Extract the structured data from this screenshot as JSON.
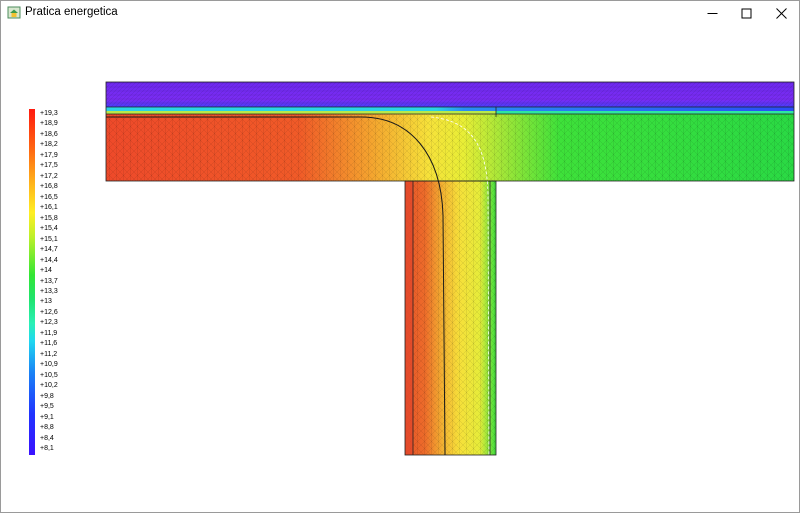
{
  "window": {
    "title": "Pratica energetica",
    "app_icon": "house-app-icon",
    "controls": [
      "minimize-icon",
      "maximize-icon",
      "close-icon"
    ]
  },
  "legend": {
    "labels": [
      "+19,3",
      "+18,9",
      "+18,6",
      "+18,2",
      "+17,9",
      "+17,5",
      "+17,2",
      "+16,8",
      "+16,5",
      "+16,1",
      "+15,8",
      "+15,4",
      "+15,1",
      "+14,7",
      "+14,4",
      "+14",
      "+13,7",
      "+13,3",
      "+13",
      "+12,6",
      "+12,3",
      "+11,9",
      "+11,6",
      "+11,2",
      "+10,9",
      "+10,5",
      "+10,2",
      "+9,8",
      "+9,5",
      "+9,1",
      "+8,8",
      "+8,4",
      "+8,1"
    ],
    "colors": {
      "max": "#ff1a0f",
      "mid": "#33e634",
      "min": "#3a12ff"
    }
  },
  "thermal_plot": {
    "description_colors": {
      "slab_top_layer": "#7b28f0",
      "interior_warm": "#f0482a",
      "transition": "#f5e03a",
      "exterior_cool": "#2fe040"
    }
  }
}
